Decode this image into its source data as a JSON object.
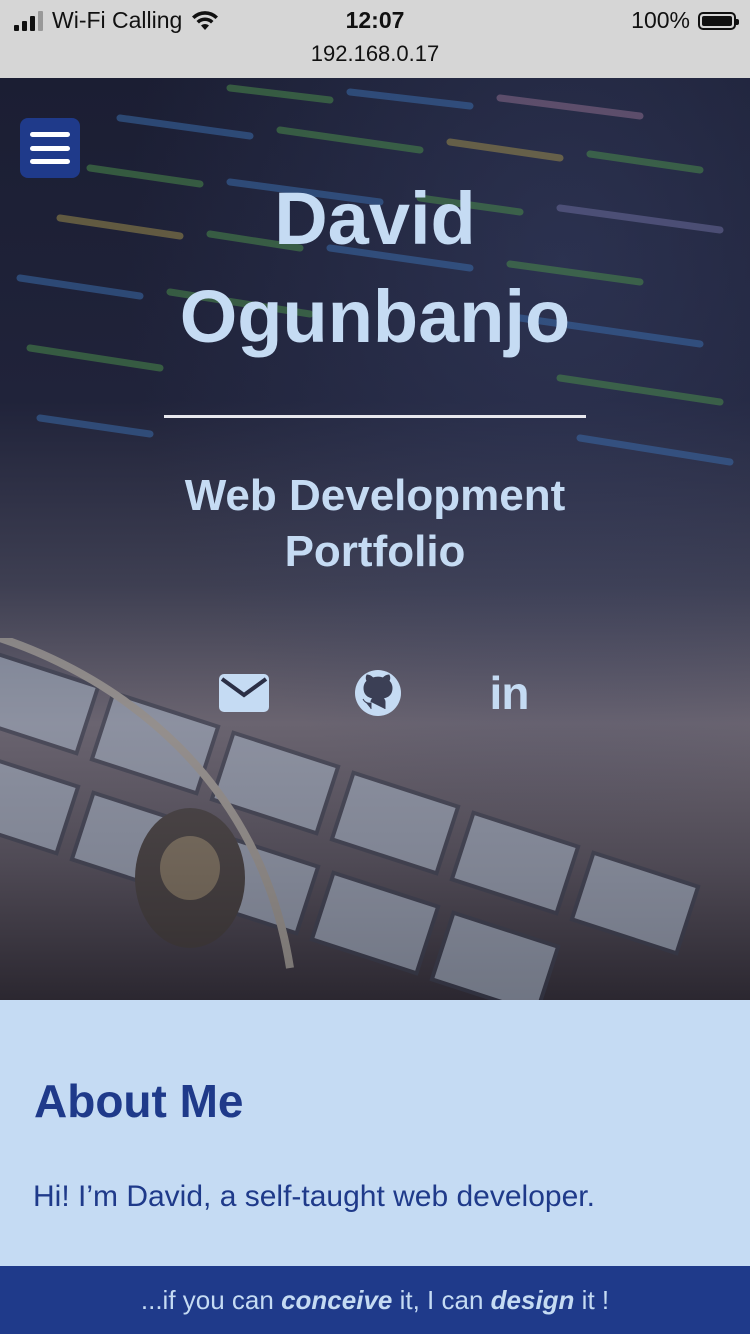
{
  "status_bar": {
    "carrier": "Wi-Fi Calling",
    "time": "12:07",
    "battery": "100%",
    "url": "192.168.0.17"
  },
  "hero": {
    "title_line1": "David",
    "title_line2": "Ogunbanjo",
    "subtitle_line1": "Web Development",
    "subtitle_line2": "Portfolio",
    "social_icons": [
      "envelope-icon",
      "github-icon",
      "linkedin-icon"
    ],
    "linkedin_text": "in"
  },
  "about": {
    "heading": "About Me",
    "text": "Hi! I’m David, a self-taught web developer."
  },
  "footer": {
    "part1": "...if you can ",
    "word1": "conceive",
    "part2": " it, I can ",
    "word2": "design",
    "part3": " it !"
  },
  "colors": {
    "accent": "#1f3a8a",
    "light": "#c5dbf3"
  }
}
